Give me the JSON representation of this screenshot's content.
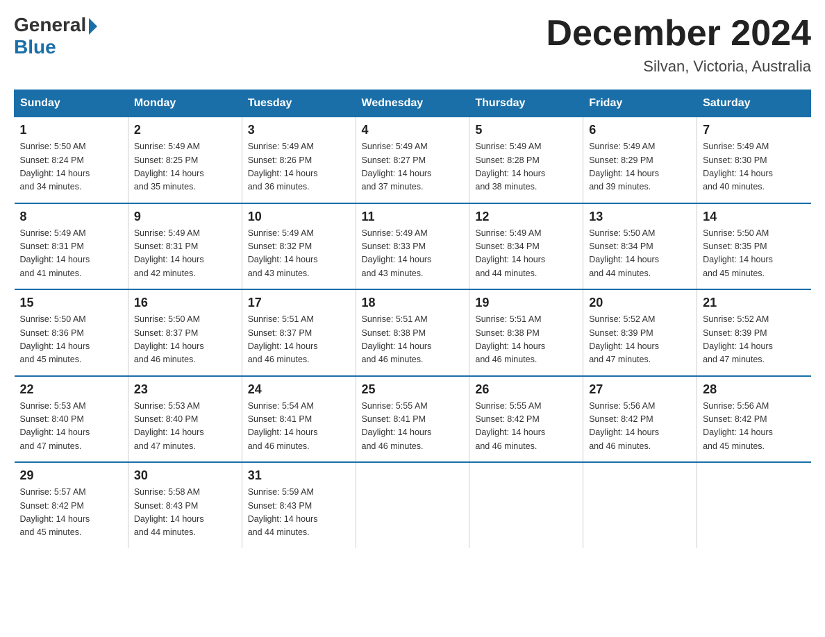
{
  "header": {
    "logo_general": "General",
    "logo_blue": "Blue",
    "month_title": "December 2024",
    "location": "Silvan, Victoria, Australia"
  },
  "days_of_week": [
    "Sunday",
    "Monday",
    "Tuesday",
    "Wednesday",
    "Thursday",
    "Friday",
    "Saturday"
  ],
  "weeks": [
    [
      {
        "num": "1",
        "sunrise": "5:50 AM",
        "sunset": "8:24 PM",
        "daylight": "14 hours and 34 minutes."
      },
      {
        "num": "2",
        "sunrise": "5:49 AM",
        "sunset": "8:25 PM",
        "daylight": "14 hours and 35 minutes."
      },
      {
        "num": "3",
        "sunrise": "5:49 AM",
        "sunset": "8:26 PM",
        "daylight": "14 hours and 36 minutes."
      },
      {
        "num": "4",
        "sunrise": "5:49 AM",
        "sunset": "8:27 PM",
        "daylight": "14 hours and 37 minutes."
      },
      {
        "num": "5",
        "sunrise": "5:49 AM",
        "sunset": "8:28 PM",
        "daylight": "14 hours and 38 minutes."
      },
      {
        "num": "6",
        "sunrise": "5:49 AM",
        "sunset": "8:29 PM",
        "daylight": "14 hours and 39 minutes."
      },
      {
        "num": "7",
        "sunrise": "5:49 AM",
        "sunset": "8:30 PM",
        "daylight": "14 hours and 40 minutes."
      }
    ],
    [
      {
        "num": "8",
        "sunrise": "5:49 AM",
        "sunset": "8:31 PM",
        "daylight": "14 hours and 41 minutes."
      },
      {
        "num": "9",
        "sunrise": "5:49 AM",
        "sunset": "8:31 PM",
        "daylight": "14 hours and 42 minutes."
      },
      {
        "num": "10",
        "sunrise": "5:49 AM",
        "sunset": "8:32 PM",
        "daylight": "14 hours and 43 minutes."
      },
      {
        "num": "11",
        "sunrise": "5:49 AM",
        "sunset": "8:33 PM",
        "daylight": "14 hours and 43 minutes."
      },
      {
        "num": "12",
        "sunrise": "5:49 AM",
        "sunset": "8:34 PM",
        "daylight": "14 hours and 44 minutes."
      },
      {
        "num": "13",
        "sunrise": "5:50 AM",
        "sunset": "8:34 PM",
        "daylight": "14 hours and 44 minutes."
      },
      {
        "num": "14",
        "sunrise": "5:50 AM",
        "sunset": "8:35 PM",
        "daylight": "14 hours and 45 minutes."
      }
    ],
    [
      {
        "num": "15",
        "sunrise": "5:50 AM",
        "sunset": "8:36 PM",
        "daylight": "14 hours and 45 minutes."
      },
      {
        "num": "16",
        "sunrise": "5:50 AM",
        "sunset": "8:37 PM",
        "daylight": "14 hours and 46 minutes."
      },
      {
        "num": "17",
        "sunrise": "5:51 AM",
        "sunset": "8:37 PM",
        "daylight": "14 hours and 46 minutes."
      },
      {
        "num": "18",
        "sunrise": "5:51 AM",
        "sunset": "8:38 PM",
        "daylight": "14 hours and 46 minutes."
      },
      {
        "num": "19",
        "sunrise": "5:51 AM",
        "sunset": "8:38 PM",
        "daylight": "14 hours and 46 minutes."
      },
      {
        "num": "20",
        "sunrise": "5:52 AM",
        "sunset": "8:39 PM",
        "daylight": "14 hours and 47 minutes."
      },
      {
        "num": "21",
        "sunrise": "5:52 AM",
        "sunset": "8:39 PM",
        "daylight": "14 hours and 47 minutes."
      }
    ],
    [
      {
        "num": "22",
        "sunrise": "5:53 AM",
        "sunset": "8:40 PM",
        "daylight": "14 hours and 47 minutes."
      },
      {
        "num": "23",
        "sunrise": "5:53 AM",
        "sunset": "8:40 PM",
        "daylight": "14 hours and 47 minutes."
      },
      {
        "num": "24",
        "sunrise": "5:54 AM",
        "sunset": "8:41 PM",
        "daylight": "14 hours and 46 minutes."
      },
      {
        "num": "25",
        "sunrise": "5:55 AM",
        "sunset": "8:41 PM",
        "daylight": "14 hours and 46 minutes."
      },
      {
        "num": "26",
        "sunrise": "5:55 AM",
        "sunset": "8:42 PM",
        "daylight": "14 hours and 46 minutes."
      },
      {
        "num": "27",
        "sunrise": "5:56 AM",
        "sunset": "8:42 PM",
        "daylight": "14 hours and 46 minutes."
      },
      {
        "num": "28",
        "sunrise": "5:56 AM",
        "sunset": "8:42 PM",
        "daylight": "14 hours and 45 minutes."
      }
    ],
    [
      {
        "num": "29",
        "sunrise": "5:57 AM",
        "sunset": "8:42 PM",
        "daylight": "14 hours and 45 minutes."
      },
      {
        "num": "30",
        "sunrise": "5:58 AM",
        "sunset": "8:43 PM",
        "daylight": "14 hours and 44 minutes."
      },
      {
        "num": "31",
        "sunrise": "5:59 AM",
        "sunset": "8:43 PM",
        "daylight": "14 hours and 44 minutes."
      },
      null,
      null,
      null,
      null
    ]
  ],
  "labels": {
    "sunrise": "Sunrise:",
    "sunset": "Sunset:",
    "daylight": "Daylight:"
  }
}
